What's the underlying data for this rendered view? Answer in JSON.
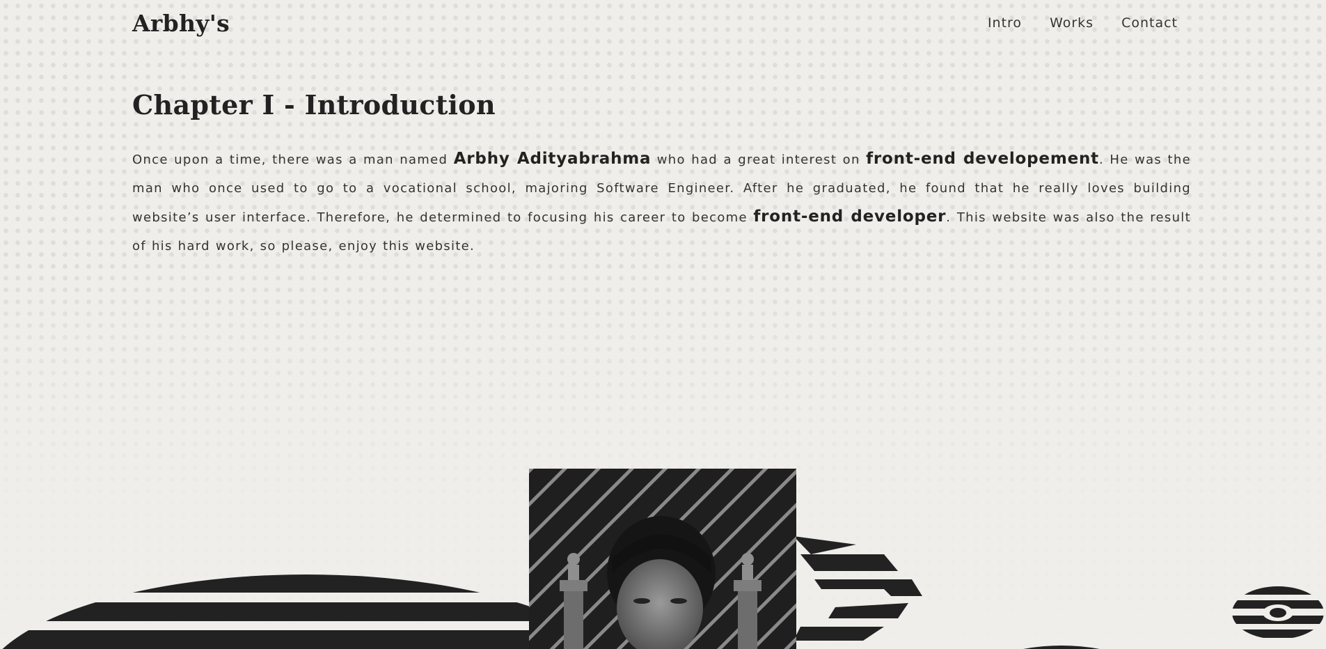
{
  "header": {
    "logo": "Arbhy's",
    "nav": [
      "Intro",
      "Works",
      "Contact"
    ]
  },
  "intro": {
    "title": "Chapter I - Introduction",
    "text_1": "Once upon a time, there was a man named ",
    "name": "Arbhy Adityabrahma",
    "text_2": " who had a great interest on ",
    "interest": "front-end developement",
    "text_3": ". He was the man who once used to go to a vocational school, majoring Software Engineer. After he graduated, he found that he really loves building website’s user interface. Therefore, he determined to focusing his career to become ",
    "career": "front-end developer",
    "text_4": ". This website was also the result of his hard work, so please, enjoy this website."
  },
  "decor": {
    "portrait": "portrait-photo",
    "accent_dark": "#222222",
    "background": "#efeeea"
  }
}
